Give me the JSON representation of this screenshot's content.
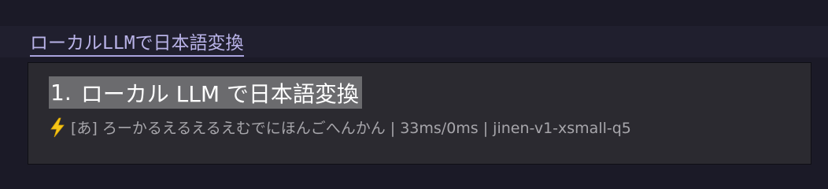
{
  "composition": {
    "text": "ローカルLLMで日本語変換"
  },
  "candidate_window": {
    "candidates": [
      {
        "number": "1.",
        "text": "ローカル LLM で日本語変換",
        "selected": true
      }
    ],
    "status": {
      "icon": "lightning-bolt-icon",
      "text": "[あ] ろーかるえるえるえむでにほんごへんかん | 33ms/0ms | jinen-v1-xsmall-q5"
    }
  },
  "colors": {
    "background": "#1b1a27",
    "composition_text": "#b9b3e8",
    "popup_background": "#2b2a30",
    "selection_highlight": "#6b6b6e",
    "status_text": "#a7a6ab",
    "bolt": "#f5c518"
  }
}
